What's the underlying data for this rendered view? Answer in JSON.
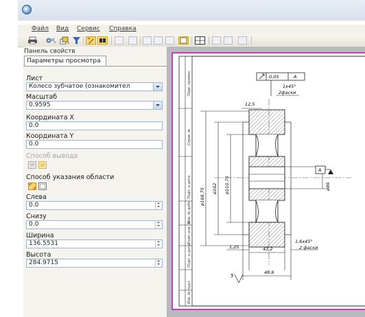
{
  "menu": {
    "file": "Файл",
    "view": "Вид",
    "service": "Сервис",
    "help": "Справка"
  },
  "toolbar_icons": [
    "printer-icon",
    "settings-icon",
    "layers-icon",
    "filter-icon",
    "select-mode-icon",
    "view-mode-icon",
    "copy-icon",
    "paste-icon",
    "zoom-icon",
    "grid-icon",
    "window-icon"
  ],
  "panel": {
    "title": "Панель свойств",
    "tab": "Параметры просмотра",
    "sheet_label": "Лист",
    "sheet_value": "Колесо зубчатое (ознакомител",
    "scale_label": "Масштаб",
    "scale_value": "0.9595",
    "coord_x_label": "Координата X",
    "coord_x_value": "0.0",
    "coord_y_label": "Координата Y",
    "coord_y_value": "0.0",
    "output_mode_label": "Способ вывода",
    "area_mode_label": "Способ указания области",
    "left_label": "Слева",
    "left_value": "0.0",
    "bottom_label": "Снизу",
    "bottom_value": "0.0",
    "width_label": "Ширина",
    "width_value": "136.5531",
    "height_label": "Высота",
    "height_value": "284.9715"
  },
  "drawing": {
    "tolerance": "0,05",
    "datum": "A",
    "datum_flag": "A",
    "chamfer": "1х45°",
    "chamfer_note": "2фаски",
    "chamfer2": "1,6х45°",
    "chamfer2_note": "2 фаски",
    "dim_roughness": "12,5",
    "dia_outer": "ø168,75",
    "dia_mid": "ø162",
    "dia_inner": "ø110,75",
    "dia_bore": "ø86",
    "hub_width": "43,2",
    "total_width": "48,6",
    "small_dim": "1,25",
    "view_mark": "5",
    "stamp_labels": [
      "Перв. примен.",
      "Справ. №",
      "Подп. и дата",
      "Инв. № дубл.",
      "Взам. инв. №",
      "Подп. и дата",
      "Инв. № подл."
    ]
  }
}
